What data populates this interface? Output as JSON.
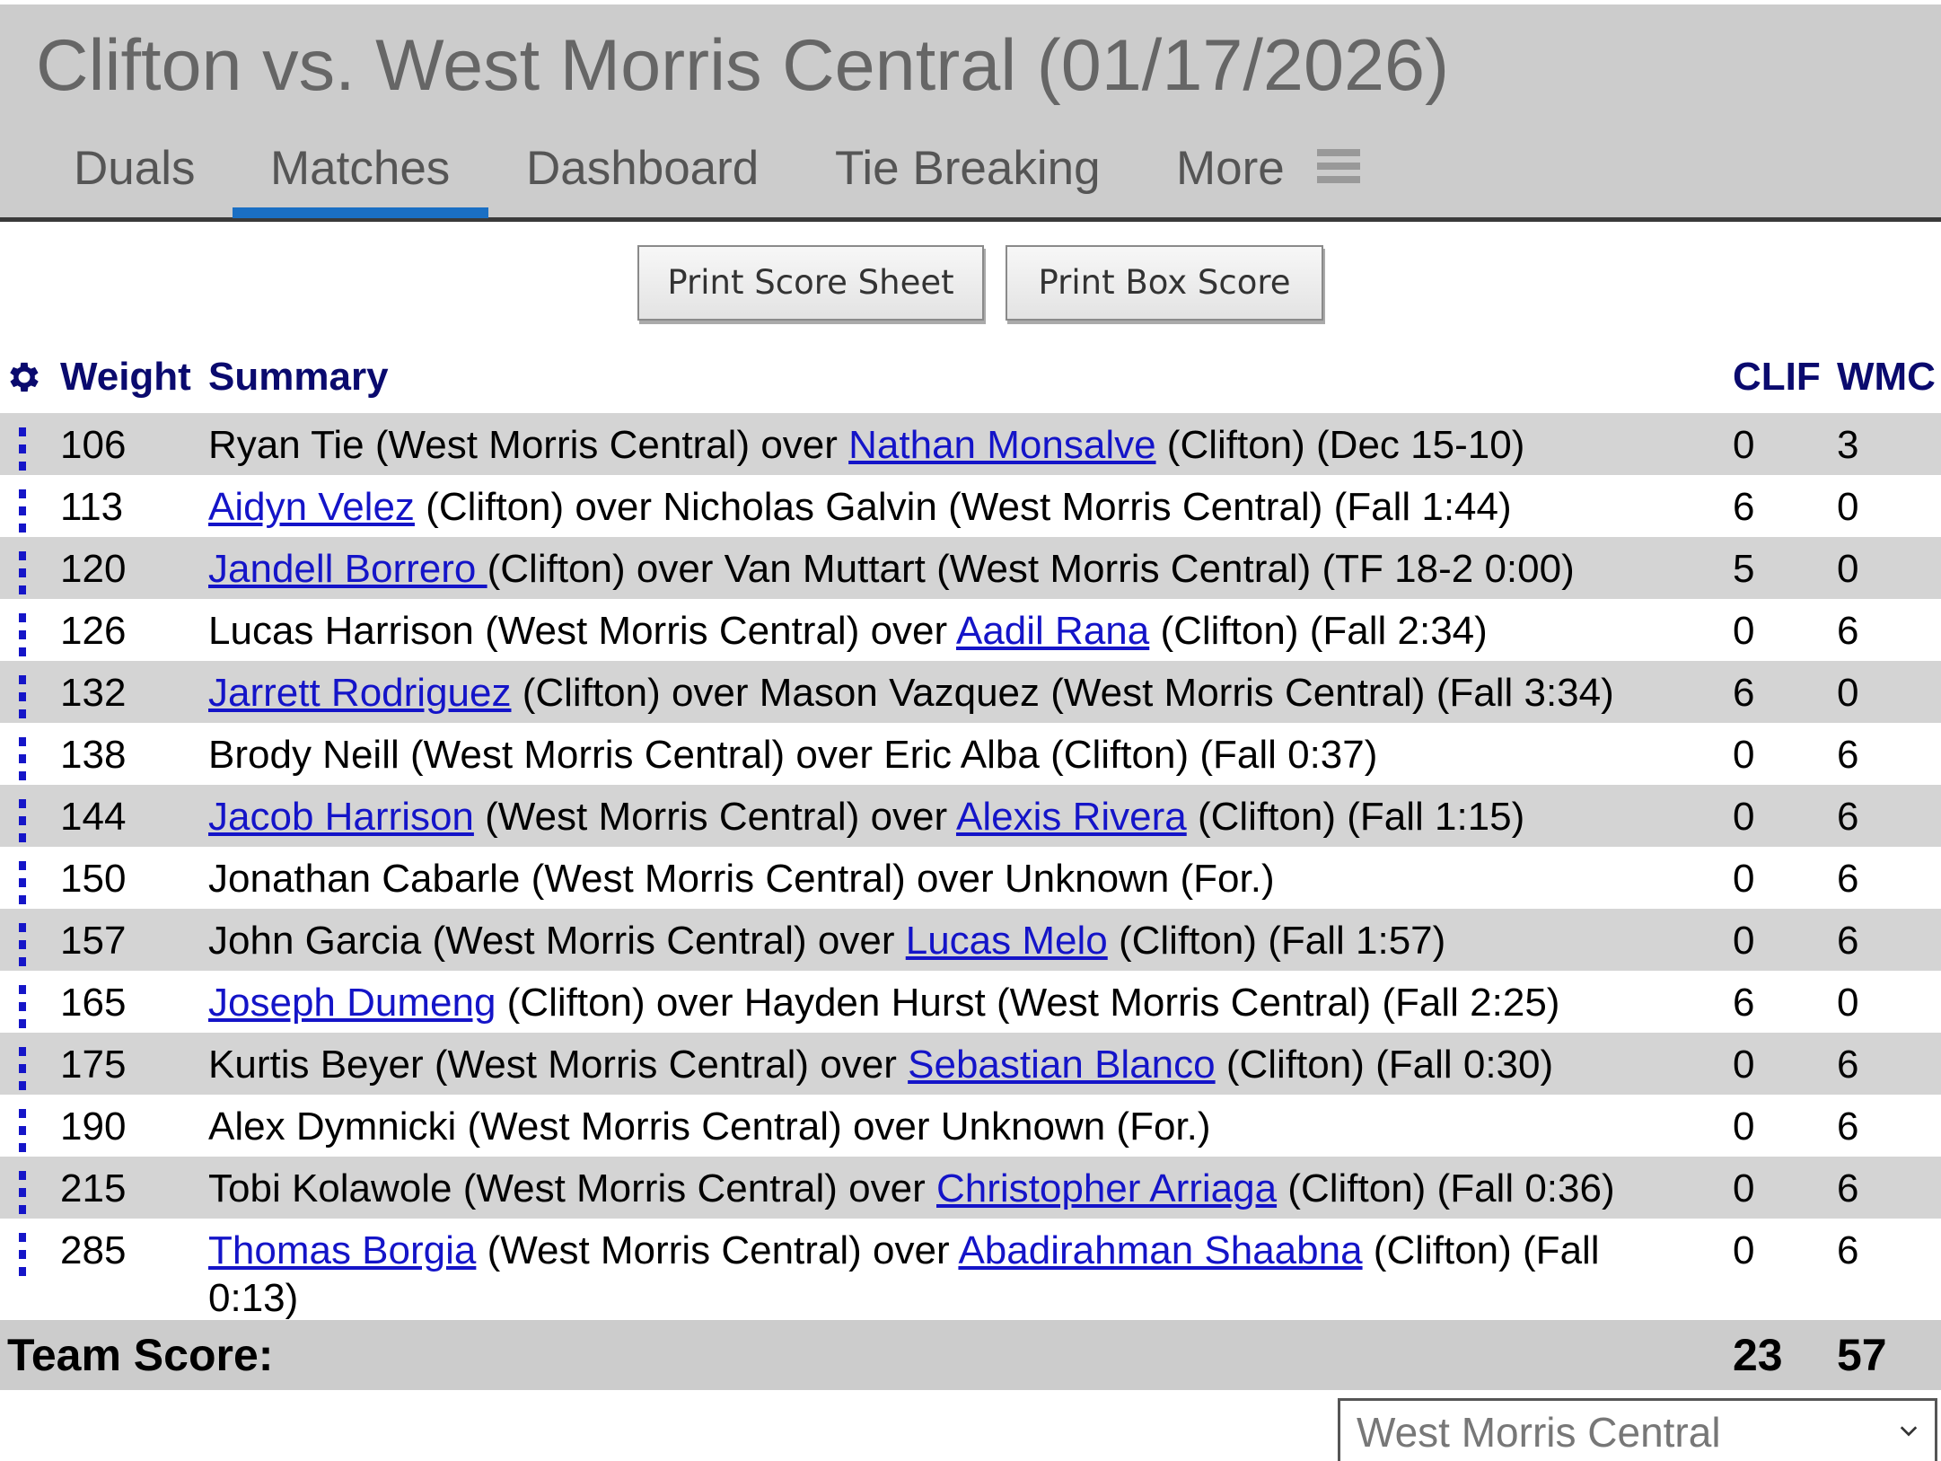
{
  "header": {
    "title": "Clifton vs. West Morris Central (01/17/2026)",
    "tabs": [
      {
        "label": "Duals"
      },
      {
        "label": "Matches"
      },
      {
        "label": "Dashboard"
      },
      {
        "label": "Tie Breaking"
      },
      {
        "label": "More"
      }
    ],
    "active_tab": "Matches",
    "menu_icon": "hamburger-icon"
  },
  "buttons": {
    "print_score_sheet": "Print Score Sheet",
    "print_box_score": "Print Box Score"
  },
  "table": {
    "settings_icon": "gear-icon",
    "columns": {
      "weight": "Weight",
      "summary": "Summary",
      "team1": "CLIF",
      "team2": "WMC"
    },
    "rows": [
      {
        "weight": "106",
        "segments": [
          {
            "text": "Ryan Tie"
          },
          {
            "text": " (West Morris Central) over "
          },
          {
            "text": "Nathan Monsalve",
            "link": true
          },
          {
            "text": " (Clifton) (Dec 15-10)"
          }
        ],
        "clif": "0",
        "wmc": "3"
      },
      {
        "weight": "113",
        "segments": [
          {
            "text": "Aidyn Velez",
            "link": true
          },
          {
            "text": " (Clifton) over Nicholas Galvin (West Morris Central) (Fall 1:44)"
          }
        ],
        "clif": "6",
        "wmc": "0"
      },
      {
        "weight": "120",
        "segments": [
          {
            "text": "Jandell Borrero ",
            "link": true
          },
          {
            "text": "(Clifton) over Van Muttart (West Morris Central) (TF 18-2 0:00)"
          }
        ],
        "clif": "5",
        "wmc": "0"
      },
      {
        "weight": "126",
        "segments": [
          {
            "text": "Lucas Harrison (West Morris Central) over "
          },
          {
            "text": "Aadil Rana",
            "link": true
          },
          {
            "text": " (Clifton) (Fall 2:34)"
          }
        ],
        "clif": "0",
        "wmc": "6"
      },
      {
        "weight": "132",
        "segments": [
          {
            "text": "Jarrett Rodriguez",
            "link": true
          },
          {
            "text": " (Clifton) over Mason Vazquez (West Morris Central) (Fall 3:34)"
          }
        ],
        "clif": "6",
        "wmc": "0"
      },
      {
        "weight": "138",
        "segments": [
          {
            "text": "Brody Neill (West Morris Central) over Eric Alba (Clifton) (Fall 0:37)"
          }
        ],
        "clif": "0",
        "wmc": "6"
      },
      {
        "weight": "144",
        "segments": [
          {
            "text": "Jacob Harrison",
            "link": true
          },
          {
            "text": " (West Morris Central) over "
          },
          {
            "text": "Alexis Rivera",
            "link": true
          },
          {
            "text": " (Clifton) (Fall 1:15)"
          }
        ],
        "clif": "0",
        "wmc": "6"
      },
      {
        "weight": "150",
        "segments": [
          {
            "text": "Jonathan Cabarle (West Morris Central) over Unknown (For.)"
          }
        ],
        "clif": "0",
        "wmc": "6"
      },
      {
        "weight": "157",
        "segments": [
          {
            "text": "John Garcia (West Morris Central) over "
          },
          {
            "text": "Lucas Melo",
            "link": true
          },
          {
            "text": " (Clifton) (Fall 1:57)"
          }
        ],
        "clif": "0",
        "wmc": "6"
      },
      {
        "weight": "165",
        "segments": [
          {
            "text": "Joseph Dumeng",
            "link": true
          },
          {
            "text": " (Clifton) over Hayden Hurst (West Morris Central) (Fall 2:25)"
          }
        ],
        "clif": "6",
        "wmc": "0"
      },
      {
        "weight": "175",
        "segments": [
          {
            "text": "Kurtis Beyer (West Morris Central) over "
          },
          {
            "text": "Sebastian Blanco",
            "link": true
          },
          {
            "text": " (Clifton) (Fall 0:30)"
          }
        ],
        "clif": "0",
        "wmc": "6"
      },
      {
        "weight": "190",
        "segments": [
          {
            "text": "Alex Dymnicki (West Morris Central) over Unknown (For.)"
          }
        ],
        "clif": "0",
        "wmc": "6"
      },
      {
        "weight": "215",
        "segments": [
          {
            "text": "Tobi Kolawole (West Morris Central) over "
          },
          {
            "text": "Christopher Arriaga",
            "link": true
          },
          {
            "text": " (Clifton) (Fall 0:36)"
          }
        ],
        "clif": "0",
        "wmc": "6"
      },
      {
        "weight": "285",
        "segments": [
          {
            "text": "Thomas Borgia",
            "link": true
          },
          {
            "text": " (West Morris Central) over "
          },
          {
            "text": "Abadirahman Shaabna",
            "link": true
          },
          {
            "text": " (Clifton) (Fall 0:13)"
          }
        ],
        "clif": "0",
        "wmc": "6"
      }
    ],
    "team_score": {
      "label": "Team Score:",
      "clif": "23",
      "wmc": "57"
    }
  },
  "team_select": {
    "value": "West Morris Central",
    "icon": "chevron-down-icon"
  },
  "colors": {
    "header_bg": "#cccccc",
    "active_tab": "#1a6fc4",
    "link": "#1414c8",
    "heading": "#0a0a6e",
    "row_shade": "#d4d4d4"
  }
}
